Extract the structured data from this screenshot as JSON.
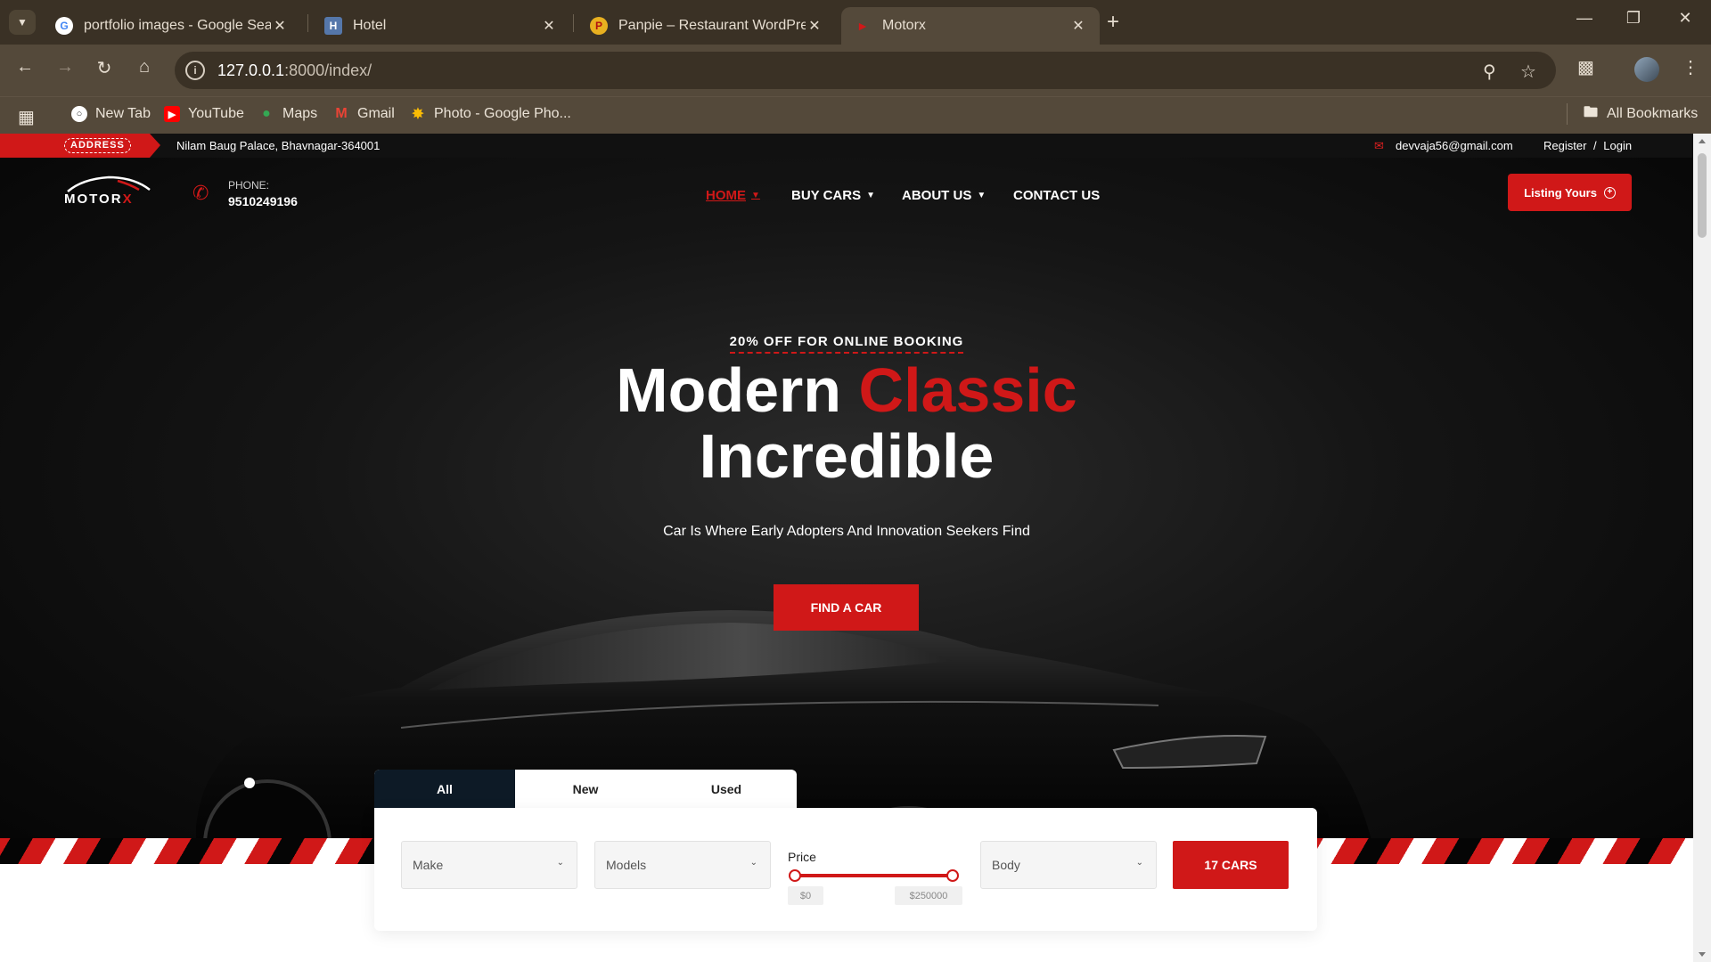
{
  "browser": {
    "tabs": [
      {
        "title": "portfolio images - Google Search",
        "favicon": "google-icon"
      },
      {
        "title": "Hotel",
        "favicon": "hotel-icon"
      },
      {
        "title": "Panpie – Restaurant WordPress",
        "favicon": "panpie-icon"
      },
      {
        "title": "Motorx",
        "favicon": "motorx-icon",
        "active": true
      }
    ],
    "url_host": "127.0.0.1",
    "url_rest": ":8000/index/",
    "bookmarks": [
      "New Tab",
      "YouTube",
      "Maps",
      "Gmail",
      "Photo - Google Pho..."
    ],
    "all_bookmarks": "All Bookmarks"
  },
  "topbar": {
    "address_badge": "ADDRESS",
    "address": "Nilam Baug Palace, Bhavnagar-364001",
    "email": "devvaja56@gmail.com",
    "register": "Register",
    "separator": "/",
    "login": "Login"
  },
  "header": {
    "logo_text": "MOTOR",
    "logo_x": "X",
    "phone_label": "PHONE:",
    "phone_number": "9510249196",
    "nav": [
      "HOME",
      "BUY CARS",
      "ABOUT US",
      "CONTACT US"
    ],
    "listing_button": "Listing Yours"
  },
  "hero": {
    "promo": "20% OFF FOR ONLINE BOOKING",
    "headline_part1": "Modern",
    "headline_accent": "Classic",
    "headline_line2": "Incredible",
    "subline": "Car Is Where Early Adopters And Innovation Seekers Find",
    "cta": "FIND A CAR"
  },
  "search": {
    "tabs": [
      "All",
      "New",
      "Used"
    ],
    "make_placeholder": "Make",
    "models_placeholder": "Models",
    "price_label": "Price",
    "price_min": "$0",
    "price_max": "$250000",
    "body_placeholder": "Body",
    "submit": "17 CARS"
  },
  "colors": {
    "brand_red": "#d01818",
    "chrome_dark": "#3a3125",
    "chrome_mid": "#54493a",
    "tab_navy": "#0d1a26"
  }
}
